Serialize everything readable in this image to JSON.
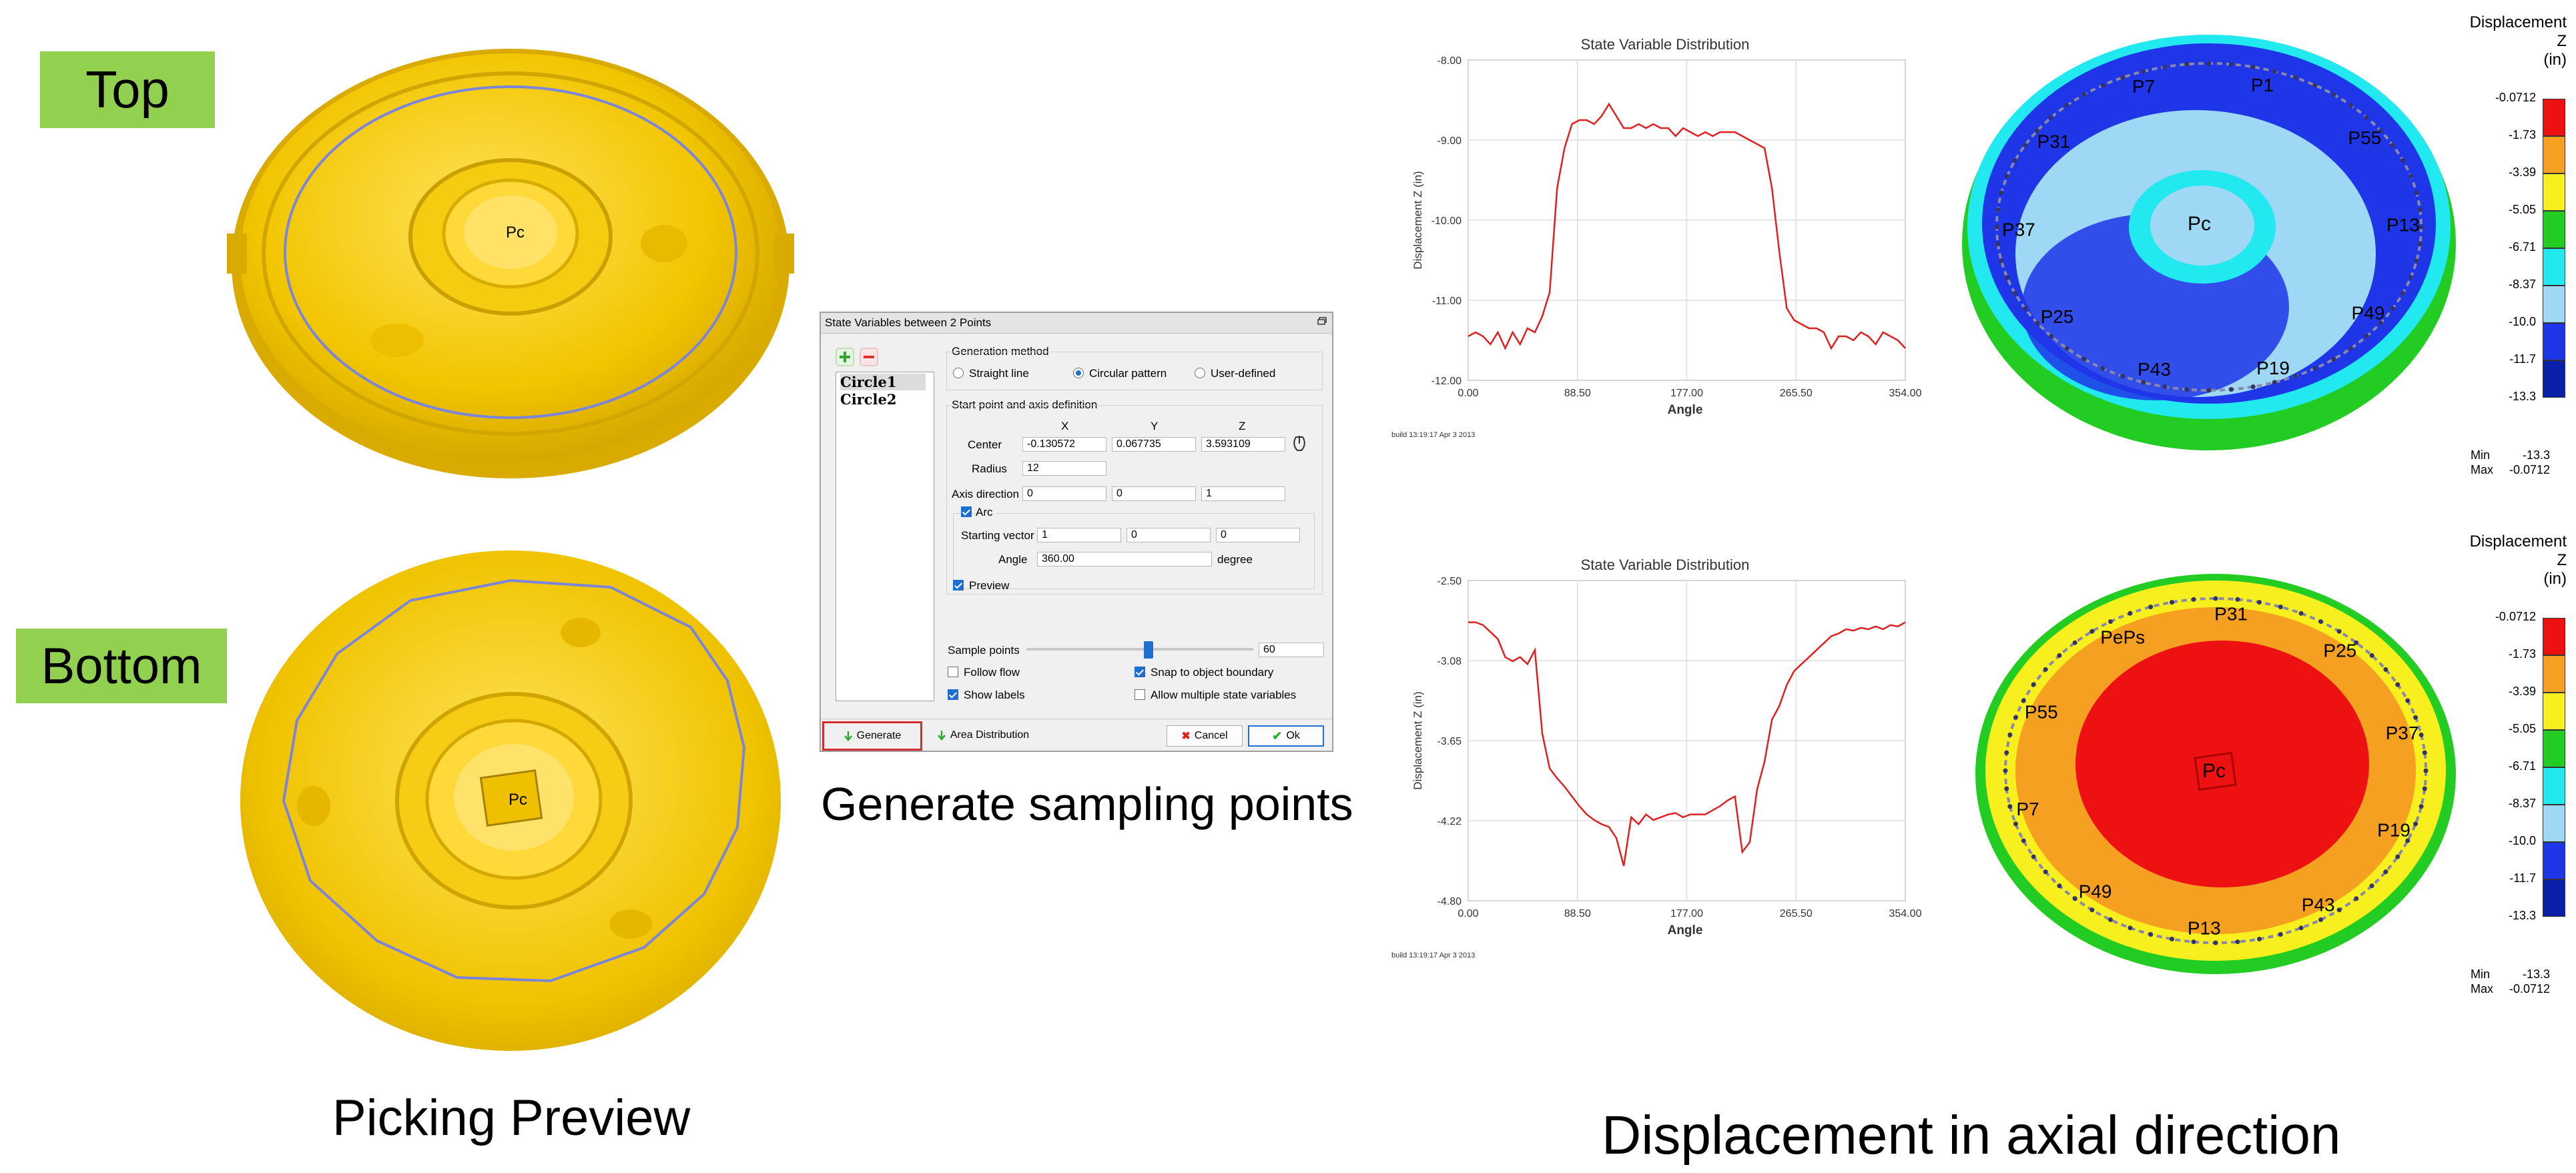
{
  "labels": {
    "top": "Top",
    "bottom": "Bottom",
    "picking_preview": "Picking Preview",
    "generate_sampling": "Generate sampling points",
    "displacement_axial": "Displacement in axial direction"
  },
  "part_labels": {
    "center": "Pc"
  },
  "dialog": {
    "title": "State Variables between 2 Points",
    "list_items": [
      "Circle1",
      "Circle2"
    ],
    "generation_method_label": "Generation method",
    "methods": [
      "Straight line",
      "Circular pattern",
      "User-defined"
    ],
    "selected_method": "Circular pattern",
    "start_point_label": "Start point and axis definition",
    "col_x": "X",
    "col_y": "Y",
    "col_z": "Z",
    "center_label": "Center",
    "center_x": "-0.130572",
    "center_y": "0.067735",
    "center_z": "3.593109",
    "radius_label": "Radius",
    "radius": "12",
    "axis_dir_label": "Axis direction",
    "axis_x": "0",
    "axis_y": "0",
    "axis_z": "1",
    "arc_label": "Arc",
    "start_vec_label": "Starting vector",
    "sv_x": "1",
    "sv_y": "0",
    "sv_z": "0",
    "angle_label": "Angle",
    "angle": "360.00",
    "degree_label": "degree",
    "preview_label": "Preview",
    "sample_points_label": "Sample points",
    "sample_points": "60",
    "follow_flow": "Follow flow",
    "snap_boundary": "Snap to object boundary",
    "show_labels": "Show labels",
    "allow_multiple": "Allow multiple state variables",
    "generate_btn": "Generate",
    "area_dist_btn": "Area Distribution",
    "cancel_btn": "Cancel",
    "ok_btn": "Ok"
  },
  "chart_data": [
    {
      "type": "line",
      "title": "State Variable Distribution",
      "xlabel": "Angle",
      "ylabel": "Displacement Z (in)",
      "xlim": [
        0,
        354
      ],
      "ylim": [
        -12.0,
        -8.0
      ],
      "x_ticks": [
        "0.00",
        "88.50",
        "177.00",
        "265.50",
        "354.00"
      ],
      "y_ticks": [
        "-8.00",
        "-9.00",
        "-10.00",
        "-11.00",
        "-12.00"
      ],
      "footer": "build 13:19:17 Apr  3 2013",
      "series": [
        {
          "color": "#e02020",
          "x": [
            0,
            6,
            12,
            18,
            24,
            30,
            36,
            42,
            48,
            54,
            60,
            66,
            72,
            78,
            84,
            90,
            96,
            102,
            108,
            114,
            120,
            126,
            132,
            138,
            144,
            150,
            156,
            162,
            168,
            174,
            180,
            186,
            192,
            198,
            204,
            210,
            216,
            222,
            228,
            234,
            240,
            246,
            252,
            258,
            264,
            270,
            276,
            282,
            288,
            294,
            300,
            306,
            312,
            318,
            324,
            330,
            336,
            342,
            348,
            354
          ],
          "y": [
            -11.45,
            -11.4,
            -11.45,
            -11.55,
            -11.4,
            -11.6,
            -11.4,
            -11.55,
            -11.35,
            -11.4,
            -11.2,
            -10.9,
            -9.6,
            -9.1,
            -8.8,
            -8.75,
            -8.75,
            -8.8,
            -8.7,
            -8.55,
            -8.7,
            -8.85,
            -8.85,
            -8.8,
            -8.85,
            -8.8,
            -8.85,
            -8.85,
            -8.95,
            -8.85,
            -8.9,
            -8.95,
            -8.9,
            -8.95,
            -8.9,
            -8.9,
            -8.9,
            -8.95,
            -9.0,
            -9.05,
            -9.1,
            -9.6,
            -10.4,
            -11.1,
            -11.25,
            -11.3,
            -11.35,
            -11.35,
            -11.4,
            -11.6,
            -11.45,
            -11.45,
            -11.5,
            -11.4,
            -11.45,
            -11.55,
            -11.4,
            -11.45,
            -11.5,
            -11.6
          ]
        }
      ]
    },
    {
      "type": "line",
      "title": "State Variable Distribution",
      "xlabel": "Angle",
      "ylabel": "Displacement Z (in)",
      "xlim": [
        0,
        354
      ],
      "ylim": [
        -4.8,
        -2.5
      ],
      "x_ticks": [
        "0.00",
        "88.50",
        "177.00",
        "265.50",
        "354.00"
      ],
      "y_ticks": [
        "-2.50",
        "-3.08",
        "-3.65",
        "-4.22",
        "-4.80"
      ],
      "footer": "build 13:19:17 Apr  3 2013",
      "series": [
        {
          "color": "#e02020",
          "x": [
            0,
            6,
            12,
            18,
            24,
            30,
            36,
            42,
            48,
            54,
            60,
            66,
            72,
            78,
            84,
            90,
            96,
            102,
            108,
            114,
            120,
            126,
            132,
            138,
            144,
            150,
            156,
            162,
            168,
            174,
            180,
            186,
            192,
            198,
            204,
            210,
            216,
            222,
            228,
            234,
            240,
            246,
            252,
            258,
            264,
            270,
            276,
            282,
            288,
            294,
            300,
            306,
            312,
            318,
            324,
            330,
            336,
            342,
            348,
            354
          ],
          "y": [
            -2.8,
            -2.8,
            -2.82,
            -2.87,
            -2.92,
            -3.05,
            -3.08,
            -3.05,
            -3.1,
            -3.0,
            -3.6,
            -3.85,
            -3.92,
            -3.98,
            -4.05,
            -4.12,
            -4.18,
            -4.22,
            -4.25,
            -4.27,
            -4.35,
            -4.55,
            -4.2,
            -4.25,
            -4.18,
            -4.22,
            -4.2,
            -4.18,
            -4.17,
            -4.2,
            -4.18,
            -4.18,
            -4.18,
            -4.15,
            -4.12,
            -4.08,
            -4.05,
            -4.45,
            -4.38,
            -4.0,
            -3.8,
            -3.5,
            -3.4,
            -3.25,
            -3.15,
            -3.1,
            -3.05,
            -3.0,
            -2.95,
            -2.9,
            -2.88,
            -2.85,
            -2.86,
            -2.84,
            -2.85,
            -2.83,
            -2.85,
            -2.82,
            -2.83,
            -2.8
          ]
        }
      ]
    }
  ],
  "legend": {
    "title_line1": "Displacement",
    "title_line2": "Z",
    "title_line3": "(in)",
    "values": [
      "-0.0712",
      "-1.73",
      "-3.39",
      "-5.05",
      "-6.71",
      "-8.37",
      "-10.0",
      "-11.7",
      "-13.3"
    ],
    "colors": [
      "#ee1111",
      "#f5a020",
      "#f8ef1f",
      "#22cc22",
      "#22e8f0",
      "#9fd8f5",
      "#1e36e8",
      "#0a1fa8",
      "#061080"
    ],
    "min_label": "Min",
    "min_value": "-13.3",
    "max_label": "Max",
    "max_value": "-0.0712"
  },
  "points_top": [
    "P7",
    "P1",
    "P55",
    "P13",
    "P49",
    "P19",
    "P43",
    "P25",
    "P37",
    "P31"
  ],
  "points_bottom": [
    "P31",
    "P25",
    "P37",
    "P19",
    "P43",
    "P13",
    "P49",
    "P7",
    "P55",
    "PePs"
  ]
}
